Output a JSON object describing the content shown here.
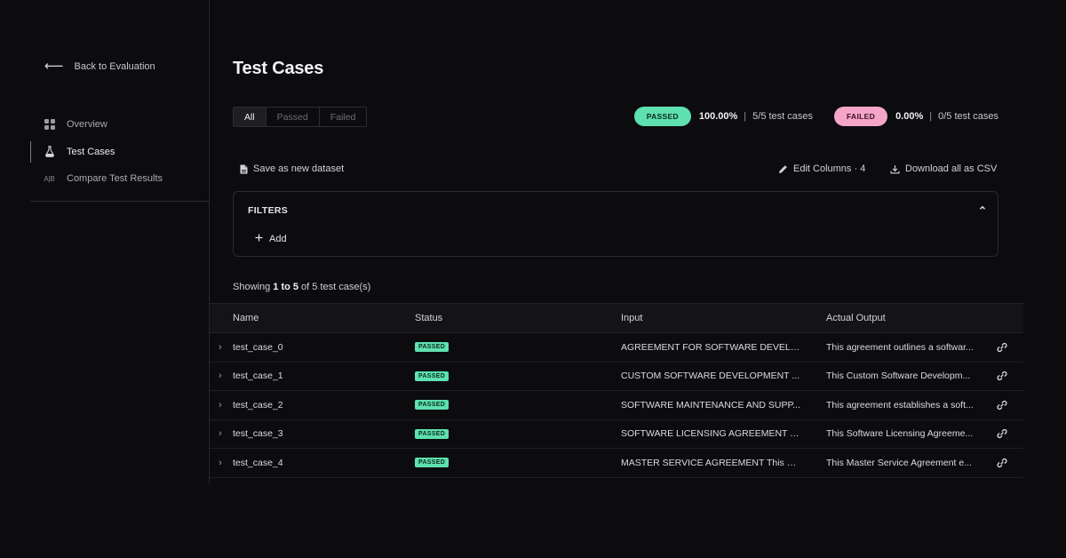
{
  "sidebar": {
    "back_label": "Back to Evaluation",
    "items": [
      {
        "label": "Overview",
        "icon": "grid-icon",
        "active": false
      },
      {
        "label": "Test Cases",
        "icon": "flask-icon",
        "active": true
      },
      {
        "label": "Compare Test Results",
        "icon": "ab-icon",
        "active": false
      }
    ],
    "compare_icon_text": "A|B"
  },
  "main": {
    "title": "Test Cases",
    "segments": [
      "All",
      "Passed",
      "Failed"
    ],
    "selected_segment": "All",
    "stats": {
      "passed_label": "PASSED",
      "passed_pct": "100.00%",
      "passed_count": "5/5 test cases",
      "failed_label": "FAILED",
      "failed_pct": "0.00%",
      "failed_count": "0/5 test cases",
      "separator": "|"
    },
    "toolbar": {
      "save_label": "Save as new dataset",
      "edit_columns_label": "Edit Columns · 4",
      "download_label": "Download all as CSV"
    },
    "filters": {
      "title": "FILTERS",
      "add_label": "Add"
    },
    "showing": {
      "prefix": "Showing ",
      "range": "1 to 5",
      "suffix": " of 5 test case(s)"
    },
    "table": {
      "columns": [
        "Name",
        "Status",
        "Input",
        "Actual Output"
      ],
      "rows": [
        {
          "name": "test_case_0",
          "status": "PASSED",
          "input": "AGREEMENT FOR SOFTWARE DEVELO...",
          "output": "This agreement outlines a softwar..."
        },
        {
          "name": "test_case_1",
          "status": "PASSED",
          "input": "CUSTOM SOFTWARE DEVELOPMENT ...",
          "output": "This Custom Software Developm..."
        },
        {
          "name": "test_case_2",
          "status": "PASSED",
          "input": "SOFTWARE MAINTENANCE AND SUPP...",
          "output": "This agreement establishes a soft..."
        },
        {
          "name": "test_case_3",
          "status": "PASSED",
          "input": "SOFTWARE LICENSING AGREEMENT T...",
          "output": "This Software Licensing Agreeme..."
        },
        {
          "name": "test_case_4",
          "status": "PASSED",
          "input": "MASTER SERVICE AGREEMENT This M...",
          "output": "This Master Service Agreement e..."
        }
      ]
    }
  },
  "colors": {
    "background": "#0c0c0f",
    "passed": "#5ee0b0",
    "failed": "#f5a6c8"
  }
}
